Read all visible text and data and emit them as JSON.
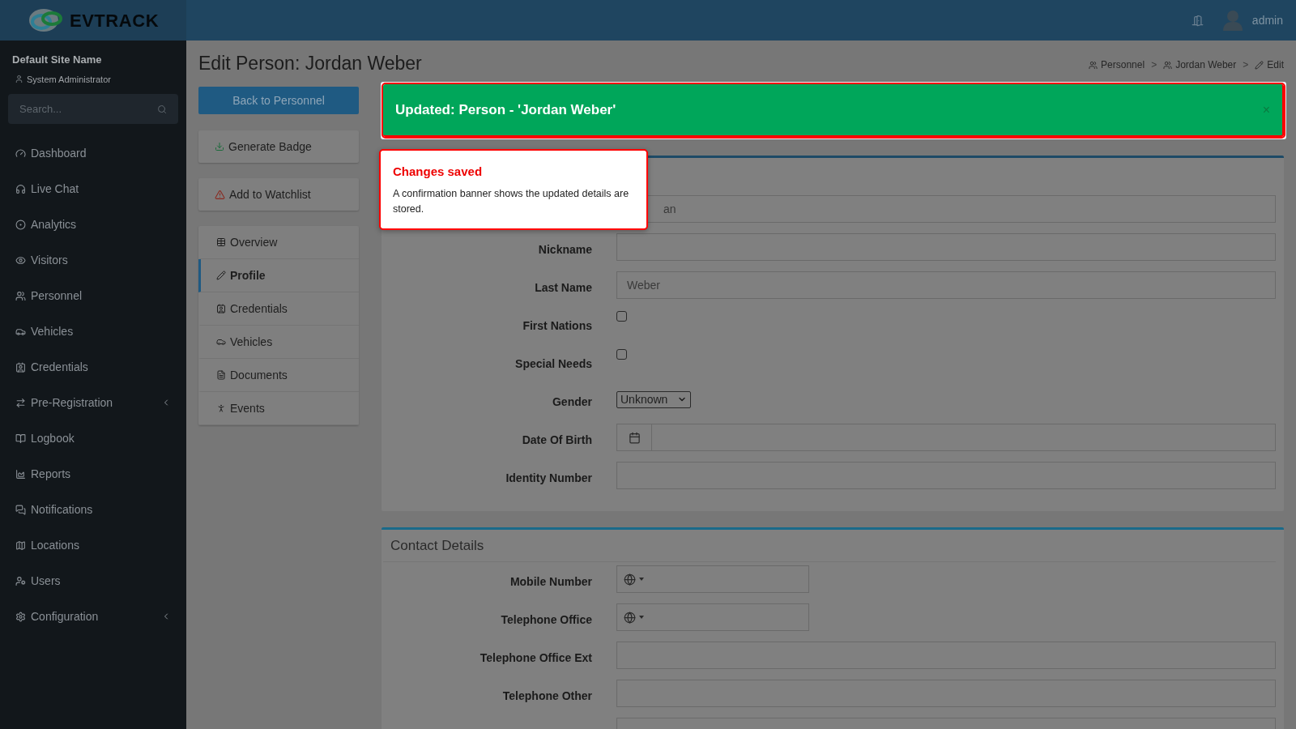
{
  "header": {
    "logo_text": "EVTRACK",
    "user": "admin"
  },
  "sidebar": {
    "site_name": "Default Site Name",
    "role": "System Administrator",
    "search": {
      "placeholder": "Search..."
    },
    "items": [
      {
        "label": "Dashboard",
        "submenu": false
      },
      {
        "label": "Live Chat",
        "submenu": false
      },
      {
        "label": "Analytics",
        "submenu": false
      },
      {
        "label": "Visitors",
        "submenu": false
      },
      {
        "label": "Personnel",
        "submenu": false
      },
      {
        "label": "Vehicles",
        "submenu": false
      },
      {
        "label": "Credentials",
        "submenu": false
      },
      {
        "label": "Pre-Registration",
        "submenu": true
      },
      {
        "label": "Logbook",
        "submenu": false
      },
      {
        "label": "Reports",
        "submenu": false
      },
      {
        "label": "Notifications",
        "submenu": false
      },
      {
        "label": "Locations",
        "submenu": false
      },
      {
        "label": "Users",
        "submenu": false
      },
      {
        "label": "Configuration",
        "submenu": true
      }
    ]
  },
  "page": {
    "title": "Edit Person: Jordan Weber",
    "breadcrumbs": [
      "Personnel",
      "Jordan Weber",
      "Edit"
    ],
    "separator": ">"
  },
  "actions": {
    "back": "Back to Personnel",
    "generate_badge": "Generate Badge",
    "add_watchlist": "Add to Watchlist"
  },
  "tabs": [
    {
      "label": "Overview",
      "selected": false
    },
    {
      "label": "Profile",
      "selected": true
    },
    {
      "label": "Credentials",
      "selected": false
    },
    {
      "label": "Vehicles",
      "selected": false
    },
    {
      "label": "Documents",
      "selected": false
    },
    {
      "label": "Events",
      "selected": false
    }
  ],
  "banner": {
    "text": "Updated: Person - 'Jordan Weber'",
    "close": "×"
  },
  "callout": {
    "title": "Changes saved",
    "body": "A confirmation banner shows the updated details are stored."
  },
  "person_form": {
    "rows": [
      {
        "kind": "text",
        "value": "an"
      },
      {
        "kind": "text",
        "label": "Nickname"
      },
      {
        "kind": "text",
        "label": "Last Name",
        "value": "Weber"
      },
      {
        "kind": "checkbox",
        "label": "First Nations",
        "checked": false
      },
      {
        "kind": "checkbox",
        "label": "Special Needs",
        "checked": false
      },
      {
        "kind": "select",
        "label": "Gender",
        "value": "Unknown"
      },
      {
        "kind": "date",
        "label": "Date Of Birth"
      },
      {
        "kind": "text",
        "label": "Identity Number"
      }
    ]
  },
  "contact_form": {
    "title": "Contact Details",
    "rows": [
      {
        "kind": "phone",
        "label": "Mobile Number"
      },
      {
        "kind": "phone",
        "label": "Telephone Office"
      },
      {
        "kind": "text",
        "label": "Telephone Office Ext"
      },
      {
        "kind": "text",
        "label": "Telephone Other"
      },
      {
        "kind": "text"
      }
    ]
  }
}
